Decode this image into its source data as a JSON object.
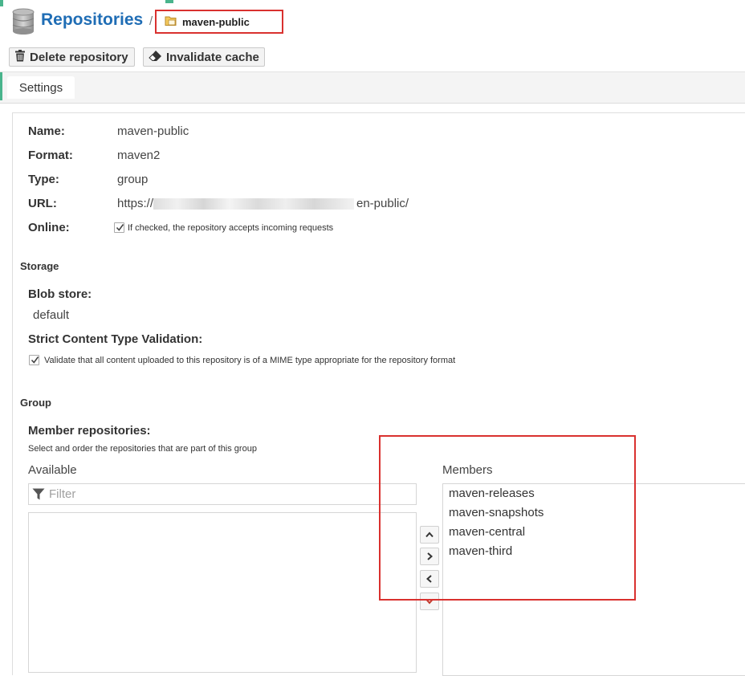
{
  "header": {
    "title": "Repositories",
    "breadcrumb_separator": "/",
    "breadcrumb_current": "maven-public"
  },
  "toolbar": {
    "delete_label": "Delete repository",
    "invalidate_label": "Invalidate cache"
  },
  "tabs": [
    {
      "label": "Settings",
      "active": true
    }
  ],
  "settings": {
    "name_label": "Name:",
    "name_value": "maven-public",
    "format_label": "Format:",
    "format_value": "maven2",
    "type_label": "Type:",
    "type_value": "group",
    "url_label": "URL:",
    "url_prefix": "https://",
    "url_suffix": "en-public/",
    "online_label": "Online:",
    "online_checked": true,
    "online_hint": "If checked, the repository accepts incoming requests"
  },
  "storage": {
    "section_title": "Storage",
    "blob_store_label": "Blob store:",
    "blob_store_value": "default",
    "strict_label": "Strict Content Type Validation:",
    "strict_checked": true,
    "strict_hint": "Validate that all content uploaded to this repository is of a MIME type appropriate for the repository format"
  },
  "group": {
    "section_title": "Group",
    "member_repos_label": "Member repositories:",
    "member_repos_hint": "Select and order the repositories that are part of this group",
    "available_label": "Available",
    "filter_placeholder": "Filter",
    "members_label": "Members",
    "members": [
      "maven-releases",
      "maven-snapshots",
      "maven-central",
      "maven-third"
    ]
  },
  "icons": {
    "title": "database-icon",
    "breadcrumb": "folder-icon",
    "delete": "trash-icon",
    "invalidate": "eraser-icon",
    "filter": "filter-icon",
    "move_up": "chevron-up-icon",
    "add": "chevron-right-icon",
    "remove": "chevron-left-icon",
    "move_down": "chevron-down-icon"
  },
  "colors": {
    "title": "#1f6db5",
    "highlight_box": "#d9312f",
    "accent": "#49b48c",
    "down_arrow": "#c0392b"
  }
}
